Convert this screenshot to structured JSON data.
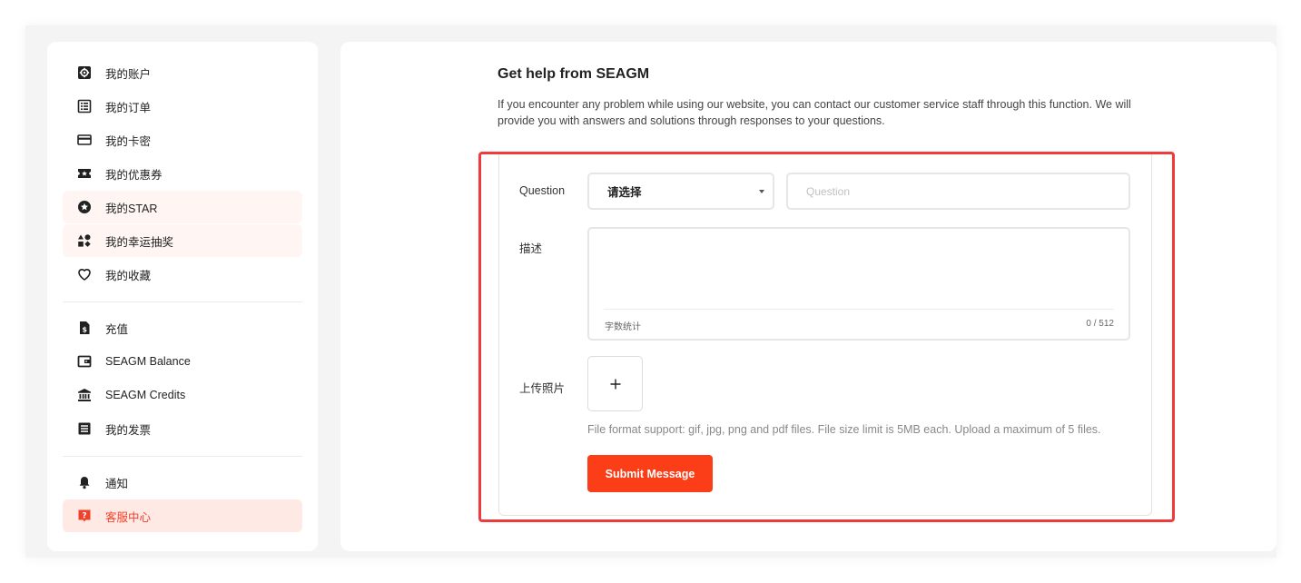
{
  "sidebar": {
    "group1": [
      {
        "label": "我的账户",
        "icon": "gear-icon"
      },
      {
        "label": "我的订单",
        "icon": "list-icon"
      },
      {
        "label": "我的卡密",
        "icon": "card-icon"
      },
      {
        "label": "我的优惠券",
        "icon": "coupon-icon"
      },
      {
        "label": "我的STAR",
        "icon": "star-icon"
      },
      {
        "label": "我的幸运抽奖",
        "icon": "lucky-draw-icon"
      },
      {
        "label": "我的收藏",
        "icon": "heart-icon"
      }
    ],
    "group2": [
      {
        "label": "充值",
        "icon": "topup-icon"
      },
      {
        "label": "SEAGM Balance",
        "icon": "wallet-icon"
      },
      {
        "label": "SEAGM Credits",
        "icon": "bank-icon"
      },
      {
        "label": "我的发票",
        "icon": "invoice-icon"
      }
    ],
    "group3": [
      {
        "label": "通知",
        "icon": "bell-icon"
      },
      {
        "label": "客服中心",
        "icon": "help-icon"
      }
    ]
  },
  "main": {
    "title": "Get help from SEAGM",
    "description": "If you encounter any problem while using our website, you can contact our customer service staff through this function. We will provide you with answers and solutions through responses to your questions.",
    "form": {
      "question_label": "Question",
      "select_value": "请选择",
      "question_placeholder": "Question",
      "description_label": "描述",
      "counter_label": "字数统计",
      "counter_value": "0 / 512",
      "upload_label": "上传照片",
      "upload_hint": "File format support: gif, jpg, png and pdf files. File size limit is 5MB each. Upload a maximum of 5 files.",
      "submit_label": "Submit Message"
    }
  },
  "colors": {
    "accent": "#fb3e18",
    "active_text": "#f0412a",
    "active_bg": "#ffe9e4",
    "highlight_border": "#ef3b3b"
  }
}
